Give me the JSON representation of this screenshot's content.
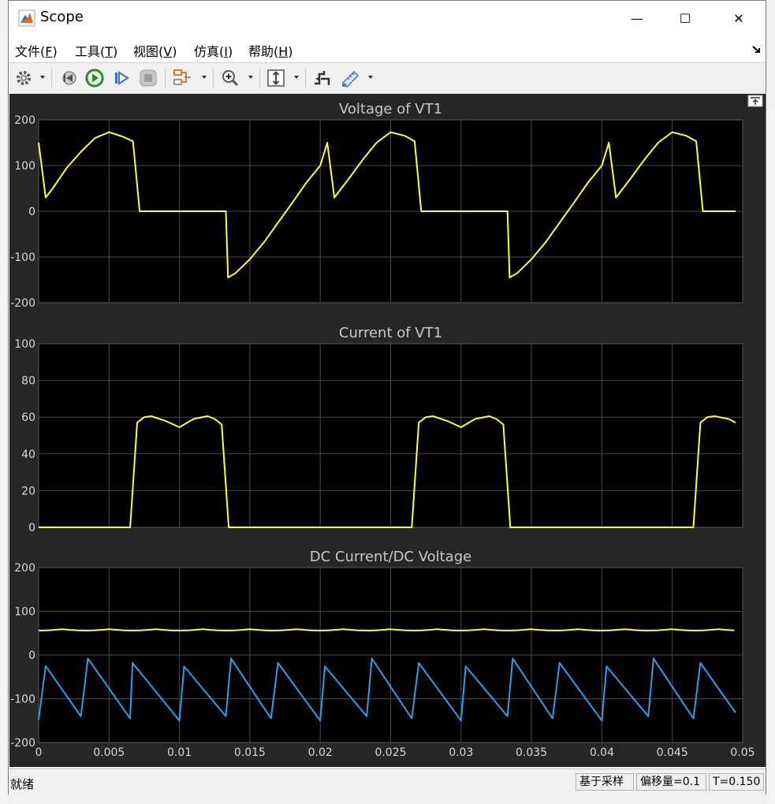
{
  "window": {
    "title": "Scope",
    "minimize": "—",
    "maximize": "☐",
    "close": "✕"
  },
  "menu": [
    {
      "label": "文件(",
      "key": "F",
      "end": ")"
    },
    {
      "label": "工具(",
      "key": "T",
      "end": ")"
    },
    {
      "label": "视图(",
      "key": "V",
      "end": ")"
    },
    {
      "label": "仿真(",
      "key": "I",
      "end": ")"
    },
    {
      "label": "帮助(",
      "key": "H",
      "end": ")"
    }
  ],
  "toolbar_icons": [
    "settings-icon",
    "step-back-icon",
    "run-icon",
    "step-forward-icon",
    "stop-icon",
    "highlight-icon",
    "zoom-icon",
    "autoscale-icon",
    "trigger-icon",
    "measure-icon"
  ],
  "status": {
    "left": "就绪",
    "sampling": "基于采样",
    "offset": "偏移量=0.1",
    "time": "T=0.150"
  },
  "colors": {
    "background": "#262626",
    "axes": "#000000",
    "grid": "#4a4a4a",
    "yellow": "#ffff33",
    "blue": "#2b9fe8"
  },
  "chart_data": [
    {
      "type": "line",
      "title": "Voltage of VT1",
      "xlim": [
        0,
        0.05
      ],
      "ylim": [
        -200,
        200
      ],
      "yticks": [
        -200,
        -100,
        0,
        100,
        200
      ],
      "xticks": [
        0,
        0.005,
        0.01,
        0.015,
        0.02,
        0.025,
        0.03,
        0.035,
        0.04,
        0.045,
        0.05
      ],
      "show_xtick_labels": false,
      "grid": true,
      "series": [
        {
          "color": "#ffff33",
          "x": [
            0,
            0.0005,
            0.001,
            0.002,
            0.003,
            0.004,
            0.005,
            0.006,
            0.0067,
            0.00717,
            0.0133,
            0.01345,
            0.014,
            0.015,
            0.016,
            0.017,
            0.018,
            0.019,
            0.02,
            0.0205,
            0.021,
            0.022,
            0.023,
            0.024,
            0.025,
            0.026,
            0.0267,
            0.02717,
            0.0333,
            0.03345,
            0.034,
            0.035,
            0.036,
            0.037,
            0.038,
            0.039,
            0.04,
            0.0405,
            0.041,
            0.042,
            0.043,
            0.044,
            0.045,
            0.046,
            0.0467,
            0.04717,
            0.0495
          ],
          "y": [
            150,
            30,
            50,
            95,
            130,
            160,
            173,
            163,
            153,
            0,
            0,
            -145,
            -135,
            -105,
            -68,
            -25,
            18,
            62,
            100,
            150,
            30,
            70,
            112,
            150,
            173,
            165,
            153,
            0,
            0,
            -145,
            -135,
            -105,
            -68,
            -25,
            18,
            62,
            100,
            150,
            30,
            70,
            112,
            150,
            173,
            165,
            153,
            0,
            0
          ]
        }
      ]
    },
    {
      "type": "line",
      "title": "Current of VT1",
      "xlim": [
        0,
        0.05
      ],
      "ylim": [
        0,
        100
      ],
      "yticks": [
        0,
        20,
        40,
        60,
        80,
        100
      ],
      "xticks": [
        0,
        0.005,
        0.01,
        0.015,
        0.02,
        0.025,
        0.03,
        0.035,
        0.04,
        0.045,
        0.05
      ],
      "show_xtick_labels": false,
      "grid": true,
      "series": [
        {
          "color": "#ffff33",
          "x": [
            0,
            0.0065,
            0.007,
            0.0075,
            0.008,
            0.009,
            0.01,
            0.011,
            0.012,
            0.0125,
            0.013,
            0.0135,
            0.0265,
            0.027,
            0.0275,
            0.028,
            0.029,
            0.03,
            0.031,
            0.032,
            0.0325,
            0.033,
            0.0335,
            0.0465,
            0.047,
            0.0475,
            0.048,
            0.049,
            0.0495
          ],
          "y": [
            0,
            0,
            57,
            60,
            60.5,
            58,
            54.5,
            59,
            60.5,
            59,
            56,
            0,
            0,
            57,
            60,
            60.5,
            58,
            54.5,
            59,
            60.5,
            59,
            56,
            0,
            0,
            57,
            60,
            60.5,
            59,
            57
          ]
        }
      ]
    },
    {
      "type": "line",
      "title": "DC Current/DC Voltage",
      "xlim": [
        0,
        0.05
      ],
      "ylim": [
        -200,
        200
      ],
      "yticks": [
        -200,
        -100,
        0,
        100,
        200
      ],
      "xticks": [
        0,
        0.005,
        0.01,
        0.015,
        0.02,
        0.025,
        0.03,
        0.035,
        0.04,
        0.045,
        0.05
      ],
      "xtick_labels": [
        "0",
        "0.005",
        "0.01",
        "0.015",
        "0.02",
        "0.025",
        "0.03",
        "0.035",
        "0.04",
        "0.045",
        "0.05"
      ],
      "show_xtick_labels": true,
      "grid": true,
      "series": [
        {
          "color": "#ffff33",
          "kind": "ripple",
          "mean": 59,
          "amplitude": 3,
          "period": 0.00333
        },
        {
          "color": "#2b9fe8",
          "x": [
            0,
            0.0005,
            0.003,
            0.0035,
            0.0065,
            0.00667,
            0.01,
            0.01033,
            0.0133,
            0.01367,
            0.0165,
            0.017,
            0.02,
            0.02033,
            0.0233,
            0.02367,
            0.0265,
            0.027,
            0.03,
            0.03033,
            0.0333,
            0.03367,
            0.0365,
            0.037,
            0.04,
            0.04033,
            0.0433,
            0.04367,
            0.0465,
            0.047,
            0.0495
          ],
          "y": [
            -148,
            -25,
            -140,
            -8,
            -145,
            -18,
            -150,
            -26,
            -140,
            -8,
            -145,
            -18,
            -150,
            -26,
            -140,
            -8,
            -145,
            -18,
            -150,
            -26,
            -140,
            -8,
            -145,
            -18,
            -150,
            -26,
            -140,
            -8,
            -145,
            -18,
            -132
          ]
        }
      ]
    }
  ]
}
